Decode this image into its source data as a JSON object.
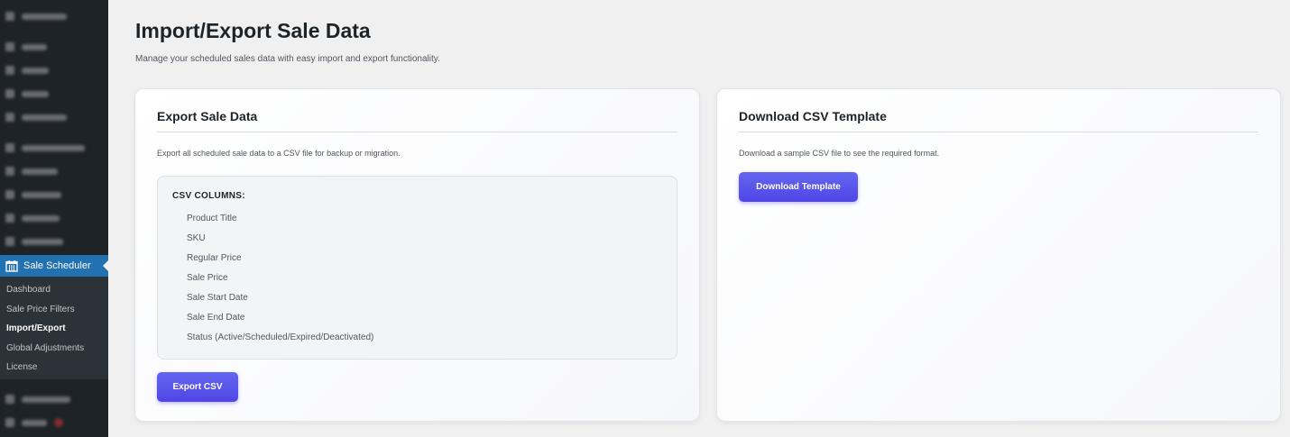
{
  "sidebar": {
    "active_menu": "Sale Scheduler",
    "submenu": [
      "Dashboard",
      "Sale Price Filters",
      "Import/Export",
      "Global Adjustments",
      "License"
    ],
    "current_submenu": "Import/Export",
    "icons": {
      "active": "calendar-icon"
    }
  },
  "page": {
    "title": "Import/Export Sale Data",
    "description": "Manage your scheduled sales data with easy import and export functionality."
  },
  "export_card": {
    "title": "Export Sale Data",
    "description": "Export all scheduled sale data to a CSV file for backup or migration.",
    "columns_title": "CSV COLUMNS:",
    "columns": [
      "Product Title",
      "SKU",
      "Regular Price",
      "Sale Price",
      "Sale Start Date",
      "Sale End Date",
      "Status (Active/Scheduled/Expired/Deactivated)"
    ],
    "button_label": "Export CSV"
  },
  "template_card": {
    "title": "Download CSV Template",
    "description": "Download a sample CSV file to see the required format.",
    "button_label": "Download Template"
  },
  "colors": {
    "sidebar_bg": "#1d2327",
    "active_menu": "#2271b1",
    "button": "#5b5bf0",
    "background": "#f0f0f1"
  }
}
